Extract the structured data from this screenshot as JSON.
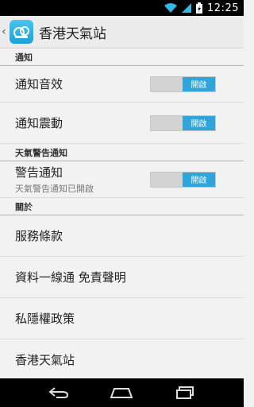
{
  "status_bar": {
    "time": "12:25"
  },
  "action_bar": {
    "title": "香港天氣站",
    "up_caret": "‹"
  },
  "sections": [
    {
      "header": "通知",
      "items": [
        {
          "title": "通知音效",
          "toggle_label": "開啟",
          "on": true
        },
        {
          "title": "通知震動",
          "toggle_label": "開啟",
          "on": true
        }
      ]
    },
    {
      "header": "天氣警告通知",
      "items": [
        {
          "title": "警告通知",
          "summary": "天氣警告通知已開啟",
          "toggle_label": "開啟",
          "on": true
        }
      ]
    },
    {
      "header": "關於",
      "items": [
        {
          "title": "服務條款"
        },
        {
          "title": "資料一線通 免責聲明"
        },
        {
          "title": "私隱權政策"
        },
        {
          "title": "香港天氣站"
        }
      ]
    }
  ],
  "colors": {
    "toggle_on": "#2fa5d9",
    "toggle_off": "#d3d3d3",
    "status_bar_bg": "#000000",
    "battery": "#33b5e5"
  },
  "icons": [
    "wifi-icon",
    "signal-icon",
    "battery-charging-icon",
    "app-cloud-icon",
    "back-icon",
    "home-icon",
    "recents-icon"
  ]
}
